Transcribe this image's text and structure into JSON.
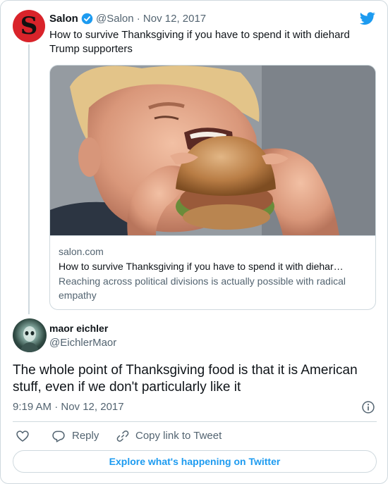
{
  "parent_tweet": {
    "avatar_letter": "S",
    "author_name": "Salon",
    "handle_date": "@Salon · Nov 12, 2017",
    "text": "How to survive Thanksgiving if you have to spend it with diehard Trump supporters",
    "link_card": {
      "domain": "salon.com",
      "title": "How to survive Thanksgiving if you have to spend it with diehar…",
      "description": "Reaching across political divisions is actually possible with radical empathy"
    }
  },
  "tweet": {
    "author_name": "maor eichler",
    "handle": "@EichlerMaor",
    "text": "The whole point of Thanksgiving food is that it is American stuff, even if we don't particularly like it",
    "timestamp": "9:19 AM · Nov 12, 2017"
  },
  "actions": {
    "reply_label": "Reply",
    "copy_link_label": "Copy link to Tweet"
  },
  "explore_label": "Explore what's happening on Twitter",
  "colors": {
    "accent": "#1d9bf0",
    "text_primary": "#0f1419",
    "text_secondary": "#536471",
    "border": "#cfd9de",
    "salon_red": "#d9232a"
  },
  "icons": [
    "salon-logo",
    "verified-badge-icon",
    "twitter-bird-icon",
    "info-icon",
    "heart-icon",
    "reply-icon",
    "link-icon"
  ]
}
